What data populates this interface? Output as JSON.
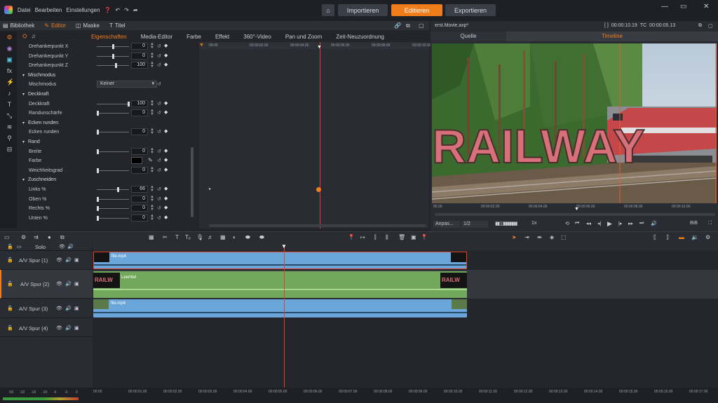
{
  "menu": [
    "Datei",
    "Bearbeiten",
    "Einstellungen"
  ],
  "top_buttons": {
    "import": "Importieren",
    "edit": "Editieren",
    "export": "Exportieren"
  },
  "tabs": [
    "Bibliothek",
    "Editor",
    "Maske",
    "Titel"
  ],
  "subtabs": [
    "Eigenschaften",
    "Media-Editor",
    "Farbe",
    "Effekt",
    "360°-Video",
    "Pan und Zoom",
    "Zeit-Neuzuordnung"
  ],
  "properties": [
    {
      "type": "row",
      "label": "Drehankerpunkt X",
      "value": "0",
      "level": 0.5
    },
    {
      "type": "row",
      "label": "Drehankerpunkt Y",
      "value": "0",
      "level": 0.5
    },
    {
      "type": "row",
      "label": "Drehankerpunkt Z",
      "value": "100",
      "level": 0.6
    },
    {
      "type": "section",
      "label": "Mischmodus"
    },
    {
      "type": "dropdown",
      "label": "Mischmodus",
      "value": "Keiner"
    },
    {
      "type": "section",
      "label": "Deckkraft"
    },
    {
      "type": "row",
      "label": "Deckkraft",
      "value": "100",
      "level": 1.0
    },
    {
      "type": "row",
      "label": "Randunschärfe",
      "value": "0",
      "level": 0.0
    },
    {
      "type": "section",
      "label": "Ecken runden"
    },
    {
      "type": "row",
      "label": "Ecken runden",
      "value": "0",
      "level": 0.0
    },
    {
      "type": "section",
      "label": "Rand"
    },
    {
      "type": "row",
      "label": "Breite",
      "value": "0",
      "level": 0.0
    },
    {
      "type": "color",
      "label": "Farbe"
    },
    {
      "type": "row",
      "label": "Weichheitsgrad",
      "value": "0",
      "level": 0.0
    },
    {
      "type": "section",
      "label": "Zuschneiden"
    },
    {
      "type": "row",
      "label": "Links %",
      "value": "66",
      "level": 0.66
    },
    {
      "type": "row",
      "label": "Oben %",
      "value": "0",
      "level": 0.0
    },
    {
      "type": "row",
      "label": "Rechts %",
      "value": "0",
      "level": 0.0
    },
    {
      "type": "row",
      "label": "Unten %",
      "value": "0",
      "level": 0.0
    }
  ],
  "kf_ruler": [
    "00:00",
    "00:00:02.00",
    "00:00:04.00",
    "00:00:06.00",
    "00:00:08.00",
    "00:00:10.00"
  ],
  "right_panel": {
    "filename": "erst.Movie.axp*",
    "timecode1": "00:00:10.19",
    "tc_label": "TC",
    "timecode2": "00:00:05.13",
    "tab_source": "Quelle",
    "tab_timeline": "Timeline",
    "railway_text": "RAILWAY",
    "ruler": [
      "00.00",
      "00:00:02.00",
      "00:00:04.00",
      "00:00:06.00",
      "00:00:08.00",
      "00:00:10.00"
    ],
    "fit": "Anpas...",
    "quality": "1/2",
    "speed": "1x",
    "pip": "BiB"
  },
  "tracks": {
    "solo": "Solo",
    "names": [
      "A/V Spur (1)",
      "A/V Spur (2)",
      "A/V Spur (3)",
      "A/V Spur (4)"
    ],
    "clip1": "file.mp4",
    "clip2": "Leertitel",
    "clip3": "file.mp4"
  },
  "timeline_ruler": [
    "00:00",
    "00:00:01.00",
    "00:00:02.00",
    "00:00:03.00",
    "00:00:04.00",
    "00:00:05.00",
    "00:00:06.00",
    "00:00:07.00",
    "00:00:08.00",
    "00:00:09.00",
    "00:00:10.00",
    "00:00:11.00",
    "00:00:12.00",
    "00:00:13.00",
    "00:00:14.00",
    "00:00:15.00",
    "00:00:16.00",
    "00:00:17.00"
  ],
  "meter_labels": [
    "-50",
    "-32",
    "-16",
    "-10",
    "-6",
    "-3",
    "0"
  ],
  "colors": {
    "accent": "#ef7d1a",
    "clip_blue": "#6aa6da",
    "clip_green": "#72a85c",
    "playhead": "#e0412f"
  }
}
